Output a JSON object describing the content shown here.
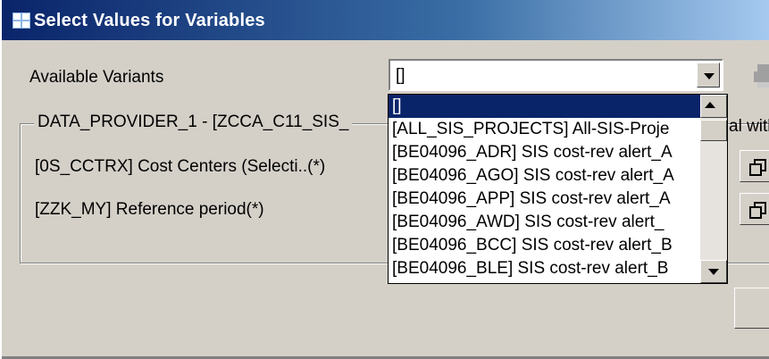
{
  "window": {
    "title": "Select Values for Variables"
  },
  "variants": {
    "label": "Available Variants",
    "selected_value": "[]"
  },
  "group": {
    "title": "DATA_PROVIDER_1 - [ZCCA_C11_SIS_",
    "trailing_text": "al with"
  },
  "variables": [
    {
      "label": "[0S_CCTRX] Cost Centers (Selecti..(*)"
    },
    {
      "label": "[ZZK_MY] Reference period(*)"
    }
  ],
  "dropdown": {
    "items": [
      "[]",
      "[ALL_SIS_PROJECTS] All-SIS-Proje",
      "[BE04096_ADR] SIS cost-rev alert_A",
      "[BE04096_AGO] SIS cost-rev alert_A",
      "[BE04096_APP] SIS cost-rev alert_A",
      "[BE04096_AWD] SIS cost-rev alert_",
      "[BE04096_BCC] SIS cost-rev alert_B",
      "[BE04096_BLE] SIS cost-rev alert_B"
    ],
    "selected_index": 0
  },
  "icons": {
    "title_icon": "grid-window-icon",
    "combo_arrow": "chevron-down-icon",
    "printer": "printer-icon",
    "copy": "copy-icon"
  },
  "colors": {
    "titlebar_start": "#0a246a",
    "titlebar_end": "#a6caf0",
    "selection": "#0a246a",
    "window_bg": "#d4d0c8"
  }
}
